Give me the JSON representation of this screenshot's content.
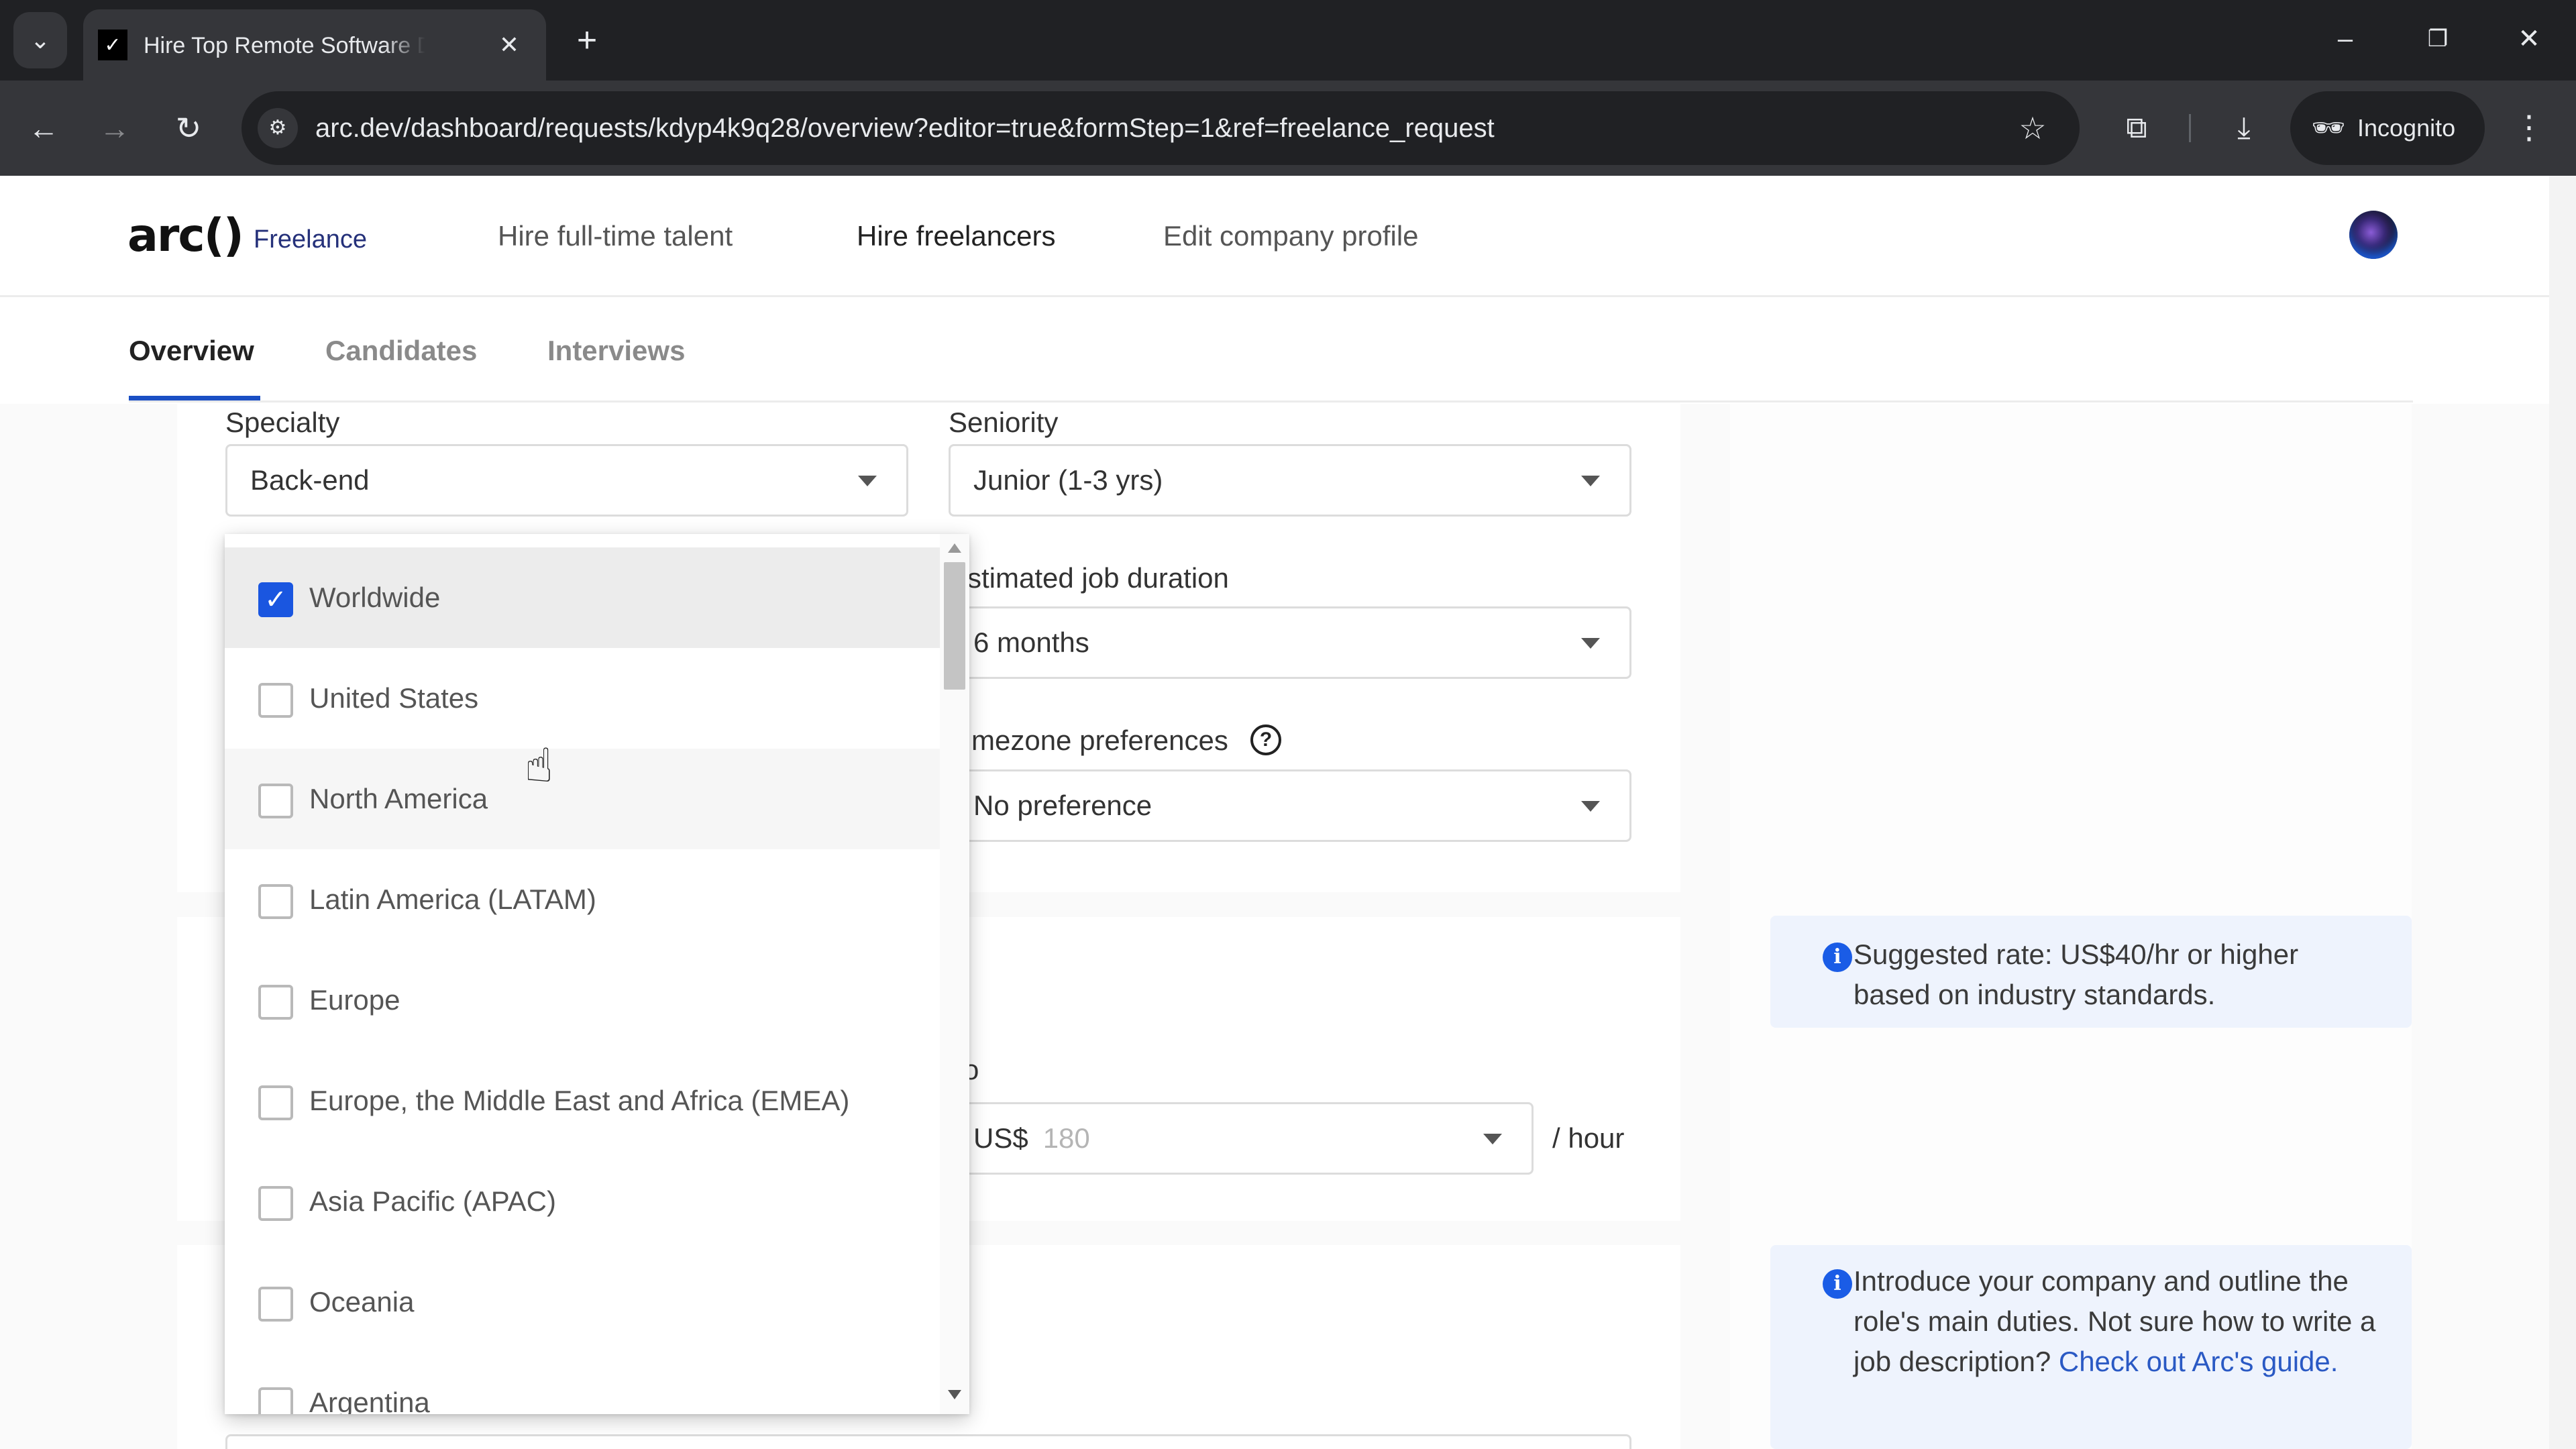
{
  "browser": {
    "tab_title": "Hire Top Remote Software Developers",
    "tab_favicon": "✓",
    "url": "arc.dev/dashboard/requests/kdyp4k9q28/overview?editor=true&formStep=1&ref=freelance_request",
    "incognito_label": "Incognito",
    "icons": {
      "tab_search": "⌄",
      "close_tab": "✕",
      "new_tab": "+",
      "minimize": "–",
      "restore": "❐",
      "close_window": "✕",
      "back": "←",
      "forward": "→",
      "reload": "↻",
      "site_info": "⚙",
      "star": "☆",
      "extensions": "⧉",
      "download": "⤓",
      "incognito": "🕶",
      "menu": "⋮"
    }
  },
  "header": {
    "logo": "arc()",
    "product": "Freelance",
    "nav": [
      {
        "label": "Hire full-time talent"
      },
      {
        "label": "Hire freelancers"
      },
      {
        "label": "Edit company profile"
      }
    ]
  },
  "subtabs": [
    {
      "label": "Overview",
      "active": true
    },
    {
      "label": "Candidates",
      "active": false
    },
    {
      "label": "Interviews",
      "active": false
    }
  ],
  "form": {
    "specialty": {
      "label": "Specialty",
      "value": "Back-end"
    },
    "seniority": {
      "label": "Seniority",
      "value": "Junior (1-3 yrs)"
    },
    "duration": {
      "label": "stimated job duration",
      "value": "6 months"
    },
    "timezone": {
      "label": "mezone preferences",
      "value": "No preference",
      "help_icon": "?"
    },
    "rate": {
      "label_fragment": "o",
      "currency": "US$",
      "placeholder": "180",
      "unit": "/ hour"
    }
  },
  "location_dropdown": {
    "items": [
      {
        "label": "Worldwide",
        "checked": true
      },
      {
        "label": "United States",
        "checked": false
      },
      {
        "label": "North America",
        "checked": false
      },
      {
        "label": "Latin America (LATAM)",
        "checked": false
      },
      {
        "label": "Europe",
        "checked": false
      },
      {
        "label": "Europe, the Middle East and Africa (EMEA)",
        "checked": false
      },
      {
        "label": "Asia Pacific (APAC)",
        "checked": false
      },
      {
        "label": "Oceania",
        "checked": false
      },
      {
        "label": "Argentina",
        "checked": false
      }
    ],
    "check_glyph": "✓"
  },
  "info": {
    "rate_tip": "Suggested rate: US$40/hr or higher based on industry standards.",
    "description_tip": "Introduce your company and outline the role's main duties. Not sure how to write a job description?",
    "description_link": "Check out Arc's guide.",
    "icon": "i"
  },
  "colors": {
    "accent": "#1a56e0",
    "link": "#2a59c4",
    "info_bg": "#eef3fd",
    "chrome_dark": "#202124",
    "chrome_mid": "#35363a"
  }
}
